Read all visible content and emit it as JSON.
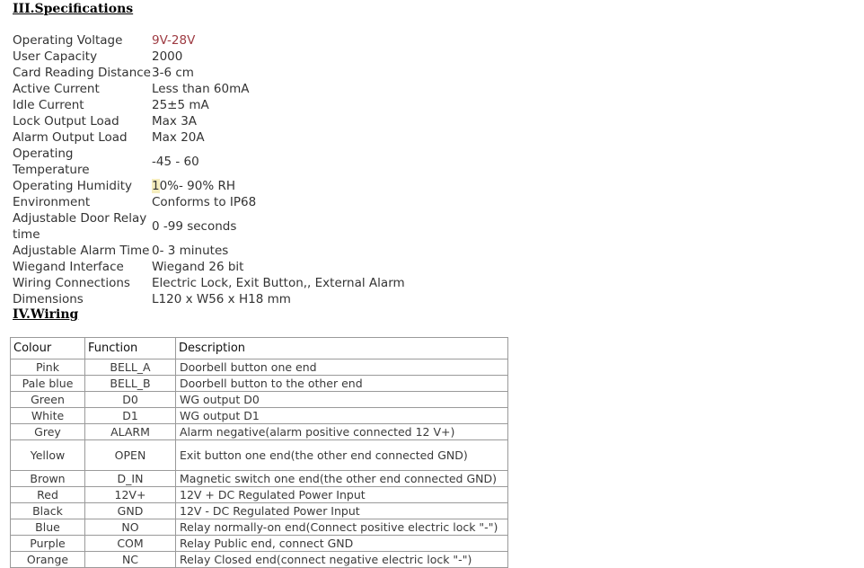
{
  "sections": {
    "specifications": {
      "heading": "III.Specifications",
      "rows": [
        {
          "label": "Operating Voltage",
          "value": "9V-28V",
          "style": "accent-red"
        },
        {
          "label": "User Capacity",
          "value": "2000",
          "style": "plain"
        },
        {
          "label": "Card Reading Distance",
          "value": "3-6 cm",
          "style": "plain"
        },
        {
          "label": "Active Current",
          "value": "Less than 60mA",
          "style": "plain"
        },
        {
          "label": "Idle Current",
          "value": "25±5 mA",
          "style": "plain"
        },
        {
          "label": "Lock Output Load",
          "value": "Max 3A",
          "style": "plain"
        },
        {
          "label": "Alarm Output Load",
          "value": "Max 20A",
          "style": "plain"
        },
        {
          "label": "Operating Temperature",
          "value": "-45 - 60",
          "style": "plain"
        },
        {
          "label": "Operating Humidity",
          "value": "10%- 90% RH",
          "style": "highlight-first"
        },
        {
          "label": "Environment",
          "value": "Conforms to IP68",
          "style": "plain"
        },
        {
          "label": "Adjustable Door Relay time",
          "value": "0 -99 seconds",
          "style": "plain"
        },
        {
          "label": "Adjustable Alarm Time",
          "value": "0- 3 minutes",
          "style": "plain"
        },
        {
          "label": "Wiegand Interface",
          "value": "Wiegand 26 bit",
          "style": "plain"
        },
        {
          "label": "Wiring Connections",
          "value": "Electric Lock, Exit Button,, External Alarm",
          "style": "plain"
        },
        {
          "label": "Dimensions",
          "value": "L120 x W56 x H18 mm",
          "style": "plain"
        }
      ]
    },
    "wiring": {
      "heading": "IV.Wiring",
      "table": {
        "columns": [
          "Colour",
          "Function",
          "Description"
        ],
        "rows": [
          {
            "colour": "Pink",
            "function": "BELL_A",
            "description": "Doorbell button one end",
            "tall": false
          },
          {
            "colour": "Pale blue",
            "function": "BELL_B",
            "description": "Doorbell button to the other end",
            "tall": false
          },
          {
            "colour": "Green",
            "function": "D0",
            "description": "WG output D0",
            "tall": false
          },
          {
            "colour": "White",
            "function": "D1",
            "description": "WG output D1",
            "tall": false
          },
          {
            "colour": "Grey",
            "function": "ALARM",
            "description": "Alarm negative(alarm positive connected 12 V+)",
            "tall": false
          },
          {
            "colour": "Yellow",
            "function": "OPEN",
            "description": "Exit button one end(the other end connected GND)",
            "tall": true
          },
          {
            "colour": "Brown",
            "function": "D_IN",
            "description": "Magnetic switch one end(the other end connected GND)",
            "tall": false
          },
          {
            "colour": "Red",
            "function": "12V+",
            "description": "12V + DC Regulated Power Input",
            "tall": false
          },
          {
            "colour": "Black",
            "function": "GND",
            "description": "12V - DC Regulated Power Input",
            "tall": false
          },
          {
            "colour": "Blue",
            "function": "NO",
            "description": "Relay normally-on end(Connect positive electric lock \"-\")",
            "tall": false
          },
          {
            "colour": "Purple",
            "function": "COM",
            "description": "Relay Public end, connect GND",
            "tall": false
          },
          {
            "colour": "Orange",
            "function": "NC",
            "description": "Relay Closed end(connect negative electric lock \"-\")",
            "tall": false
          }
        ]
      }
    }
  },
  "colors": {
    "page_background": "#ffffff",
    "body_text": "#333333",
    "heading_text": "#000000",
    "accent_red": "#9e3b42",
    "highlight_yellow": "#f5edbe",
    "table_border": "#9a9a9a"
  }
}
